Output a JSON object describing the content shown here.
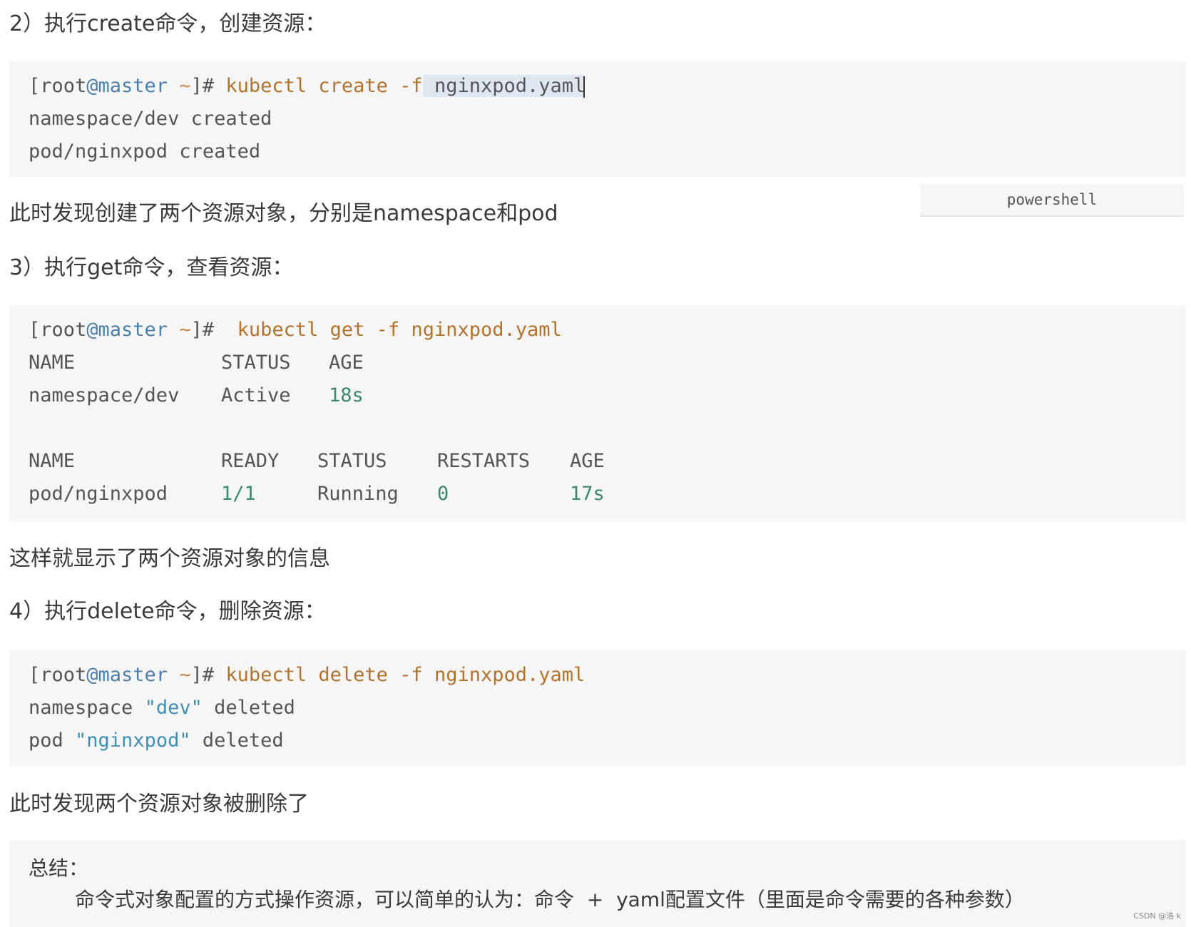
{
  "sections": {
    "h2": "2）执行create命令，创建资源：",
    "p2": "此时发现创建了两个资源对象，分别是namespace和pod",
    "h3": "3）执行get命令，查看资源：",
    "p3": "这样就显示了两个资源对象的信息",
    "h4": "4）执行delete命令，删除资源：",
    "p4": "此时发现两个资源对象被删除了"
  },
  "code_lang_tag": "powershell",
  "prompt": {
    "open": "[root",
    "host": "@master",
    "tilde": " ~",
    "close": "]#"
  },
  "create": {
    "cmd": " kubectl create -f",
    "file": " nginxpod.yaml",
    "out": [
      "namespace/dev created",
      "pod/nginxpod created"
    ]
  },
  "get": {
    "cmd": "  kubectl get -f nginxpod.yaml",
    "table1": {
      "headers": [
        "NAME",
        "STATUS",
        "AGE"
      ],
      "row": [
        "namespace/dev",
        "Active",
        "18s"
      ]
    },
    "table2": {
      "headers": [
        "NAME",
        "READY",
        "STATUS",
        "RESTARTS",
        "AGE"
      ],
      "row": [
        "pod/nginxpod",
        "1/1",
        "Running",
        "0",
        "17s"
      ]
    }
  },
  "delete": {
    "cmd": " kubectl delete -f nginxpod.yaml",
    "out1": {
      "a": "namespace ",
      "s": "\"dev\"",
      "b": " deleted"
    },
    "out2": {
      "a": "pod ",
      "s": "\"nginxpod\"",
      "b": " deleted"
    }
  },
  "summary": {
    "title": "总结：",
    "body": "命令式对象配置的方式操作资源，可以简单的认为：命令  +  yaml配置文件（里面是命令需要的各种参数）"
  },
  "watermark": "CSDN @浩 k"
}
